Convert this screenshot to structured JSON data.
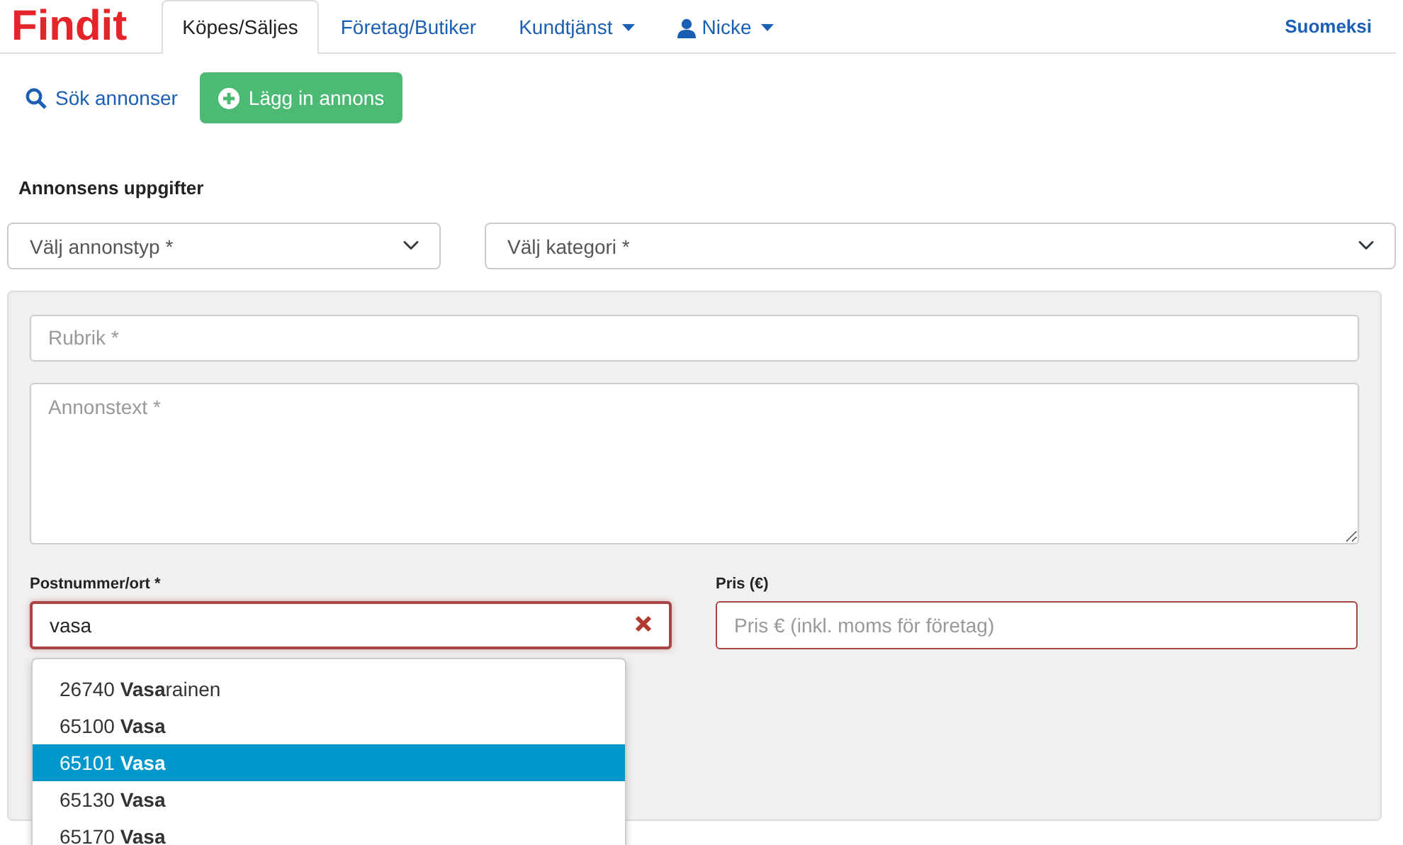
{
  "logo": "Findit",
  "tabs": [
    {
      "label": "Köpes/Säljes",
      "selected": true,
      "kind": "plain"
    },
    {
      "label": "Företag/Butiker",
      "selected": false,
      "kind": "plain"
    },
    {
      "label": "Kundtjänst",
      "selected": false,
      "kind": "dropdown"
    },
    {
      "label": "Nicke",
      "selected": false,
      "kind": "account"
    }
  ],
  "language_link": "Suomeksi",
  "search_link": "Sök annonser",
  "add_button": "Lägg in annons",
  "section_title": "Annonsens uppgifter",
  "selects": [
    {
      "placeholder": "Välj annonstyp *"
    },
    {
      "placeholder": "Välj kategori *"
    }
  ],
  "headline_field": {
    "placeholder": "Rubrik *"
  },
  "text_field": {
    "placeholder": "Annonstext *"
  },
  "postcode": {
    "label": "Postnummer/ort *",
    "value": "vasa",
    "invalid": true
  },
  "price": {
    "label": "Pris (€)",
    "placeholder": "Pris € (inkl. moms för företag)",
    "invalid": true
  },
  "suggestions": [
    {
      "text": "26740 **Vasa**rainen",
      "selected": false
    },
    {
      "text": "65100 **Vasa**",
      "selected": false
    },
    {
      "text": "65101 **Vasa**",
      "selected": true
    },
    {
      "text": "65130 **Vasa**",
      "selected": false
    },
    {
      "text": "65170 **Vasa**",
      "selected": false
    }
  ]
}
